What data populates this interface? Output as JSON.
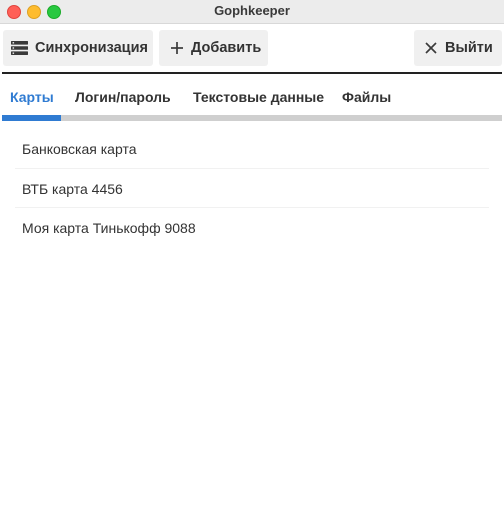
{
  "window": {
    "title": "Gophkeeper"
  },
  "toolbar": {
    "sync_label": "Синхронизация",
    "add_label": "Добавить",
    "exit_label": "Выйти"
  },
  "tabs": [
    {
      "label": "Карты",
      "active": true
    },
    {
      "label": "Логин/пароль",
      "active": false
    },
    {
      "label": "Текстовые данные",
      "active": false
    },
    {
      "label": "Файлы",
      "active": false
    }
  ],
  "cards": [
    {
      "label": "Банковская карта"
    },
    {
      "label": "ВТБ карта 4456"
    },
    {
      "label": "Моя карта Тинькофф 9088"
    }
  ],
  "colors": {
    "accent": "#2f7bd2",
    "close": "#ff5f57",
    "minimize": "#febc2e",
    "maximize": "#28c840"
  }
}
